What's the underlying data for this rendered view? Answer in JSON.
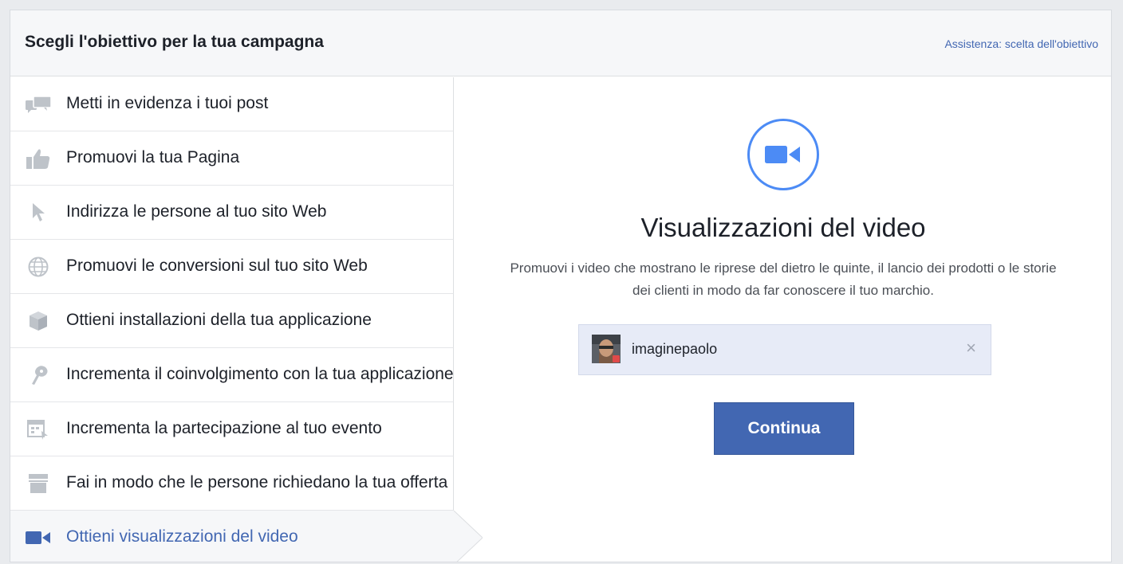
{
  "header": {
    "title": "Scegli l'obiettivo per la tua campagna",
    "help_link": "Assistenza: scelta dell'obiettivo"
  },
  "sidebar": {
    "items": [
      {
        "label": "Metti in evidenza i tuoi post",
        "icon": "boost-post-icon"
      },
      {
        "label": "Promuovi la tua Pagina",
        "icon": "thumbs-up-icon"
      },
      {
        "label": "Indirizza le persone al tuo sito Web",
        "icon": "cursor-icon"
      },
      {
        "label": "Promuovi le conversioni sul tuo sito Web",
        "icon": "globe-icon"
      },
      {
        "label": "Ottieni installazioni della tua applicazione",
        "icon": "box-icon"
      },
      {
        "label": "Incrementa il coinvolgimento con la tua applicazione",
        "icon": "joystick-icon"
      },
      {
        "label": "Incrementa la partecipazione al tuo evento",
        "icon": "calendar-icon"
      },
      {
        "label": "Fai in modo che le persone richiedano la tua offerta",
        "icon": "store-icon"
      },
      {
        "label": "Ottieni visualizzazioni del video",
        "icon": "video-camera-icon",
        "selected": true
      }
    ]
  },
  "content": {
    "icon": "video-camera-icon",
    "title": "Visualizzazioni del video",
    "description": "Promuovi i video che mostrano le riprese del dietro le quinte, il lancio dei prodotti o le storie dei clienti in modo da far conoscere il tuo marchio.",
    "page_selector": {
      "name": "imaginepaolo",
      "clear_symbol": "×"
    },
    "continue_label": "Continua"
  },
  "colors": {
    "accent": "#4267b2",
    "circle": "#4c8bf5",
    "icon_gray": "#bec3c9"
  }
}
